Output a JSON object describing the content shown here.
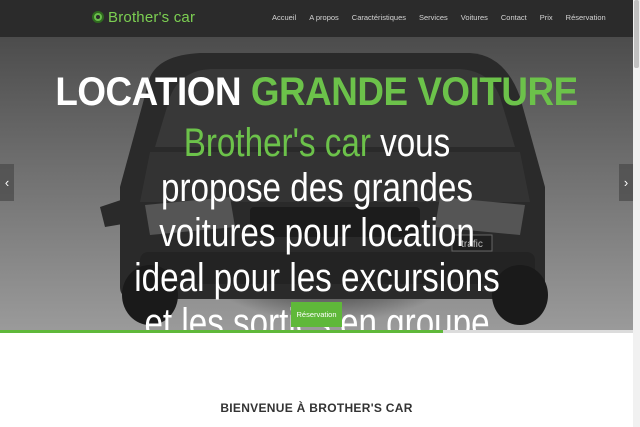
{
  "navbar": {
    "brand": "Brother's car",
    "links": [
      "Accueil",
      "A propos",
      "Caractéristiques",
      "Services",
      "Voitures",
      "Contact",
      "Prix",
      "Réservation"
    ]
  },
  "hero": {
    "title_part1": "LOCATION",
    "title_part2": "GRANDE VOITURE",
    "text_accent": "Brother's car",
    "text_rest": " vous propose des grandes voitures pour location ideal pour les excursions et les sorties en groupe",
    "button": "Réservation",
    "slide_progress": 0.7,
    "prev_arrow": "‹",
    "next_arrow": "›",
    "vehicle_badge": "trafic"
  },
  "section": {
    "welcome_title": "BIENVENUE À BROTHER'S CAR"
  },
  "colors": {
    "accent": "#6cc24a",
    "navbar_bg": "#2b2b2b",
    "button_bg": "#5fb83a"
  }
}
